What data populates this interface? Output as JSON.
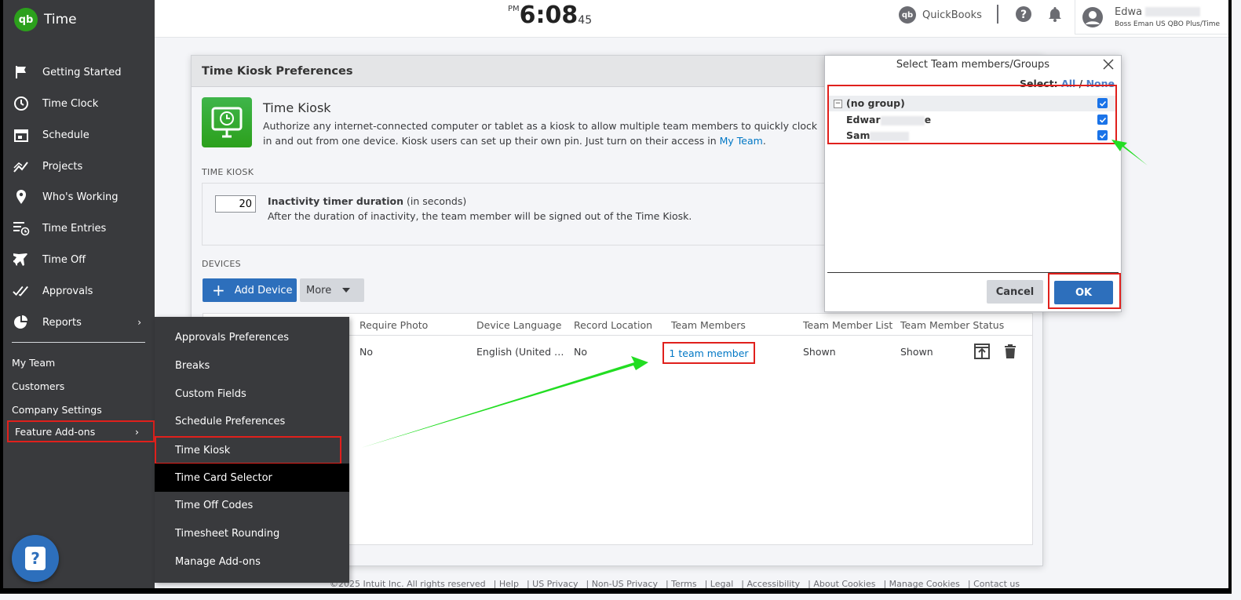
{
  "app": {
    "logo_text": "qb",
    "name": "Time"
  },
  "sidebar": {
    "items": [
      {
        "label": "Getting Started",
        "icon": "flag-icon"
      },
      {
        "label": "Time Clock",
        "icon": "clock-icon"
      },
      {
        "label": "Schedule",
        "icon": "calendar-icon"
      },
      {
        "label": "Projects",
        "icon": "projects-chart-icon"
      },
      {
        "label": "Who's Working",
        "icon": "location-pin-icon"
      },
      {
        "label": "Time Entries",
        "icon": "time-entries-icon"
      },
      {
        "label": "Time Off",
        "icon": "airplane-icon"
      },
      {
        "label": "Approvals",
        "icon": "double-check-icon"
      },
      {
        "label": "Reports",
        "icon": "pie-chart-icon"
      }
    ],
    "secondary": [
      "My Team",
      "Customers",
      "Company Settings"
    ],
    "feature_addons": "Feature Add-ons",
    "help_label": "?"
  },
  "header": {
    "clock": {
      "ampm": "PM",
      "time": "6:08",
      "seconds": "45"
    },
    "quickbooks_label": "QuickBooks",
    "qb_mini": "qb",
    "user": {
      "name": "Edwa",
      "company": "Boss Eman US QBO Plus/Time"
    }
  },
  "prefs": {
    "title": "Time Kiosk Preferences",
    "kiosk_title": "Time Kiosk",
    "kiosk_desc": "Authorize any internet-connected computer or tablet as a kiosk to allow multiple team members to quickly clock in and out from one device. Kiosk users can set up their own pin. Just turn on their access in ",
    "kiosk_link": "My Team",
    "kiosk_desc_end": ".",
    "section_time_kiosk": "TIME KIOSK",
    "timer_value": "20",
    "timer_title": "Inactivity timer duration",
    "timer_unit": " (in seconds)",
    "timer_desc": "After the duration of inactivity, the team member will be signed out of the Time Kiosk.",
    "section_devices": "DEVICES",
    "add_device": "Add Device",
    "more": "More",
    "table": {
      "headers": [
        "Require Photo",
        "Device Language",
        "Record Location",
        "Team Members",
        "Team Member List",
        "Team Member Status"
      ],
      "row": {
        "require_photo": "No",
        "device_language": "English (United …",
        "record_location": "No",
        "team_members": "1 team member",
        "member_list": "Shown",
        "member_status": "Shown"
      }
    }
  },
  "addons_menu": {
    "items": [
      "Approvals Preferences",
      "Breaks",
      "Custom Fields",
      "Schedule Preferences",
      "Time Kiosk",
      "Time Card Selector",
      "Time Off Codes",
      "Timesheet Rounding",
      "Manage Add-ons"
    ]
  },
  "select_popup": {
    "title": "Select Team members/Groups",
    "select_label": "Select:",
    "all": "All",
    "slash": " / ",
    "none": "None",
    "group": {
      "expander": "−",
      "name": "(no group)",
      "checked": true
    },
    "members": [
      {
        "name_start": "Edwar",
        "name_end": "e",
        "checked": true
      },
      {
        "name_start": "Sam",
        "name_end": "",
        "checked": true
      }
    ],
    "cancel": "Cancel",
    "ok": "OK"
  },
  "footer": [
    "©2025 Intuit Inc. All rights reserved",
    "Help",
    "US Privacy",
    "Non-US Privacy",
    "Terms",
    "Legal",
    "Accessibility",
    "About Cookies",
    "Manage Cookies",
    "Contact us"
  ],
  "colors": {
    "sidebar_bg": "#393a3d",
    "brand_green": "#2ca01c",
    "primary_blue": "#2d6fbc",
    "link_blue": "#0077c5",
    "highlight_red": "#e0201c",
    "arrow_green": "#22dd22"
  }
}
